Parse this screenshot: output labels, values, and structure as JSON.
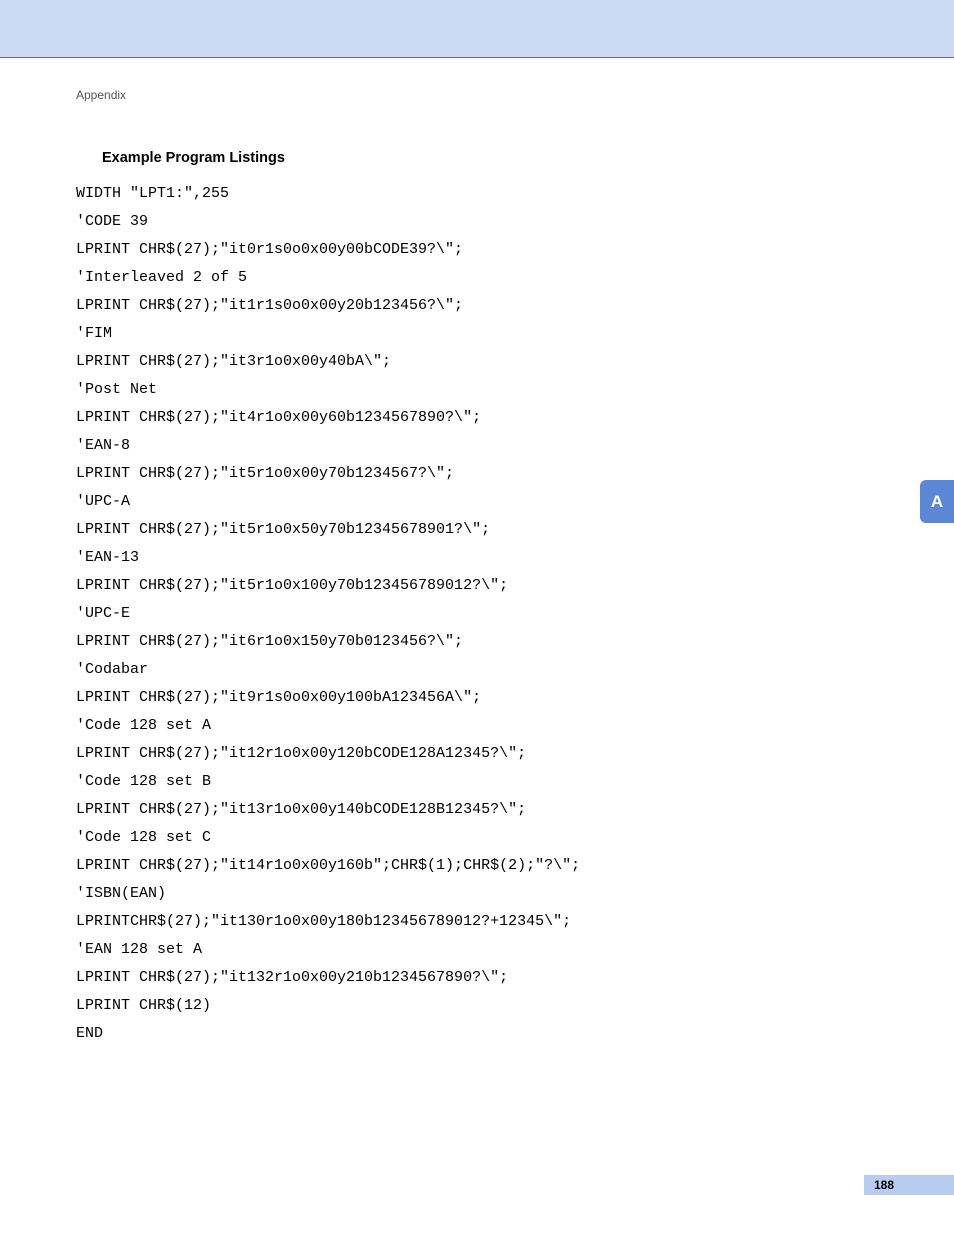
{
  "header": {
    "breadcrumb": "Appendix"
  },
  "section": {
    "title": "Example Program Listings"
  },
  "code": {
    "l0": "WIDTH \"LPT1:\",255",
    "l1": "'CODE 39",
    "l2": "LPRINT CHR$(27);\"it0r1s0o0x00y00bCODE39?\\\";",
    "l3": "'Interleaved 2 of 5",
    "l4": "LPRINT CHR$(27);\"it1r1s0o0x00y20b123456?\\\";",
    "l5": "'FIM",
    "l6": "LPRINT CHR$(27);\"it3r1o0x00y40bA\\\";",
    "l7": "'Post Net",
    "l8": "LPRINT CHR$(27);\"it4r1o0x00y60b1234567890?\\\";",
    "l9": "'EAN-8",
    "l10": "LPRINT CHR$(27);\"it5r1o0x00y70b1234567?\\\";",
    "l11": "'UPC-A",
    "l12": "LPRINT CHR$(27);\"it5r1o0x50y70b12345678901?\\\";",
    "l13": "'EAN-13",
    "l14": "LPRINT CHR$(27);\"it5r1o0x100y70b123456789012?\\\";",
    "l15": "'UPC-E",
    "l16": "LPRINT CHR$(27);\"it6r1o0x150y70b0123456?\\\";",
    "l17": "'Codabar",
    "l18": "LPRINT CHR$(27);\"it9r1s0o0x00y100bA123456A\\\";",
    "l19": "'Code 128 set A",
    "l20": "LPRINT CHR$(27);\"it12r1o0x00y120bCODE128A12345?\\\";",
    "l21": "'Code 128 set B",
    "l22": "LPRINT CHR$(27);\"it13r1o0x00y140bCODE128B12345?\\\";",
    "l23": "'Code 128 set C",
    "l24": "LPRINT CHR$(27);\"it14r1o0x00y160b\";CHR$(1);CHR$(2);\"?\\\";",
    "l25": "'ISBN(EAN)",
    "l26": "LPRINTCHR$(27);\"it130r1o0x00y180b123456789012?+12345\\\";",
    "l27": "'EAN 128 set A",
    "l28": "LPRINT CHR$(27);\"it132r1o0x00y210b1234567890?\\\";",
    "l29": "LPRINT CHR$(12)",
    "l30": "END"
  },
  "side_tab": {
    "label": "A"
  },
  "footer": {
    "page": "188"
  }
}
